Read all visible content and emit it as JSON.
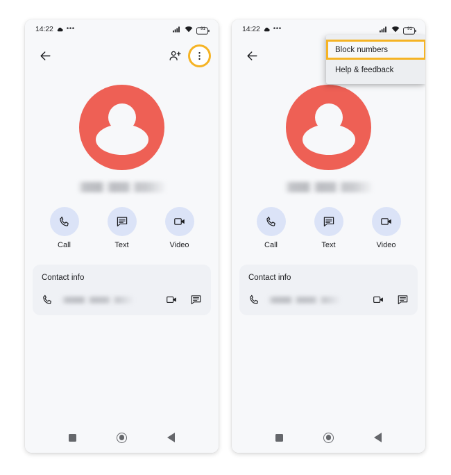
{
  "panels": [
    {
      "id": "left",
      "status_bar": {
        "time": "14:22",
        "weather_icon": "cloud-icon",
        "more_icon": "status-more-dots-icon",
        "signal_icon": "signal-bars-icon",
        "wifi_icon": "wifi-icon",
        "battery_icon": "battery-icon",
        "battery_level": "91"
      },
      "app_bar": {
        "back_icon": "back-arrow-icon",
        "add_contact_icon": "person-add-icon",
        "overflow_icon": "overflow-menu-icon",
        "overflow_highlighted": true
      },
      "contact": {
        "avatar_icon": "person-avatar-icon",
        "name": "",
        "name_redacted": true
      },
      "actions": [
        {
          "label": "Call",
          "icon": "phone-icon"
        },
        {
          "label": "Text",
          "icon": "message-icon"
        },
        {
          "label": "Video",
          "icon": "video-camera-icon"
        }
      ],
      "contact_info": {
        "title": "Contact info",
        "phone_icon": "phone-icon",
        "number": "",
        "number_redacted": true,
        "row_video_icon": "video-camera-icon",
        "row_message_icon": "message-icon"
      },
      "nav_bar": {
        "recents_icon": "recents-square-icon",
        "home_icon": "home-circle-icon",
        "back_icon": "back-triangle-icon"
      },
      "menu": null
    },
    {
      "id": "right",
      "status_bar": {
        "time": "14:22",
        "weather_icon": "cloud-icon",
        "more_icon": "status-more-dots-icon",
        "signal_icon": "signal-bars-icon",
        "wifi_icon": "wifi-icon",
        "battery_icon": "battery-icon",
        "battery_level": "91"
      },
      "app_bar": {
        "back_icon": "back-arrow-icon",
        "add_contact_icon": "person-add-icon",
        "overflow_icon": "overflow-menu-icon",
        "overflow_highlighted": false
      },
      "contact": {
        "avatar_icon": "person-avatar-icon",
        "name": "",
        "name_redacted": true
      },
      "actions": [
        {
          "label": "Call",
          "icon": "phone-icon"
        },
        {
          "label": "Text",
          "icon": "message-icon"
        },
        {
          "label": "Video",
          "icon": "video-camera-icon"
        }
      ],
      "contact_info": {
        "title": "Contact info",
        "phone_icon": "phone-icon",
        "number": "",
        "number_redacted": true,
        "row_video_icon": "video-camera-icon",
        "row_message_icon": "message-icon"
      },
      "nav_bar": {
        "recents_icon": "recents-square-icon",
        "home_icon": "home-circle-icon",
        "back_icon": "back-triangle-icon"
      },
      "menu": {
        "items": [
          {
            "label": "Block numbers",
            "highlighted": true
          },
          {
            "label": "Help & feedback",
            "highlighted": false
          }
        ]
      }
    }
  ],
  "colors": {
    "highlight": "#f5b324",
    "avatar": "#ee6055",
    "action_circle": "#dbe3f7",
    "screen_bg": "#f7f8fa",
    "card_bg": "#eff1f5",
    "menu_bg": "#eceef1",
    "text": "#1c1d20",
    "nav_icon": "#65676b"
  }
}
